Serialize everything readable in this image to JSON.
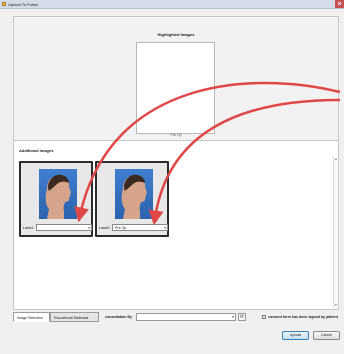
{
  "window": {
    "title": "Upload To Portal",
    "close_icon": "close-icon",
    "title_icon": "app-icon"
  },
  "highlighted": {
    "title": "Highlighted Images",
    "caption": "Pre Op"
  },
  "additional": {
    "title": "Additional Images",
    "images": [
      {
        "label_text": "Label:",
        "value": ""
      },
      {
        "label_text": "Label:",
        "value": "Pre Op"
      }
    ]
  },
  "tabs": [
    {
      "label": "Image Selection",
      "active": true
    },
    {
      "label": "Educational Materials",
      "active": false
    }
  ],
  "consultation": {
    "label": "consultation By",
    "value": ""
  },
  "consent": {
    "label": "consent form has been signed by patient",
    "checked": false
  },
  "buttons": {
    "upload": "Upload",
    "cancel": "Cancel"
  },
  "colors": {
    "arrow": "#e04848",
    "photo_bg": "#3f7fcf",
    "close": "#c75050"
  }
}
